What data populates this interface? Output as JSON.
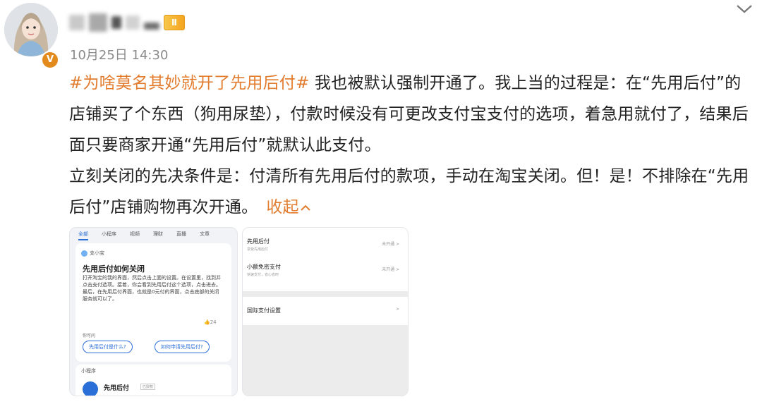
{
  "user": {
    "name_hidden": "",
    "level_badge": "Ⅱ",
    "verified_badge": "V"
  },
  "post": {
    "timestamp": "10月25日 14:30",
    "hashtag": "#为啥莫名其妙就开了先用后付#",
    "paragraph1": " 我也被默认强制开通了。我上当的过程是：在“先用后付”的店铺买了个东西（狗用尿垫），付款时候没有可更改支付宝支付的选项，着急用就付了，结果后面只要商家开通“先用后付”就默认此支付。",
    "paragraph2": "立刻关闭的先决条件是：付清所有先用后付的款项，手动在淘宝关闭。但！是！不排除在“先用后付”店铺购物再次开通。",
    "collapse_label": "收起"
  },
  "thumb1": {
    "tabs": [
      "全部",
      "小程序",
      "视频",
      "理财",
      "直播",
      "文章"
    ],
    "assistant": "支小宝",
    "title": "先用后付如何关闭",
    "body": "打开淘宝的我的界面，然后点击上面的设置。在设置里，找到并点击支付选项。接着，你会看到先用后付这个选项，点击进去。最后，在先用后付界面，也就是0元付的界面，点击底部的关闭服务就可以了。",
    "like_count": "24",
    "related_label": "你可问",
    "pill1": "先用后付是什么?",
    "pill2": "如何申请先用后付?",
    "mini_label": "小程序",
    "mini_title": "先用后付",
    "mini_badge": "已授权"
  },
  "thumb2": {
    "rows": [
      {
        "title": "先用后付",
        "sub": "享受先用后付",
        "value": "未开通 >"
      },
      {
        "title": "小额免密支付",
        "sub": "快速支付，省心省时",
        "value": "未开通 >"
      }
    ],
    "intl": "国际支付设置",
    "intl_arrow": ">"
  }
}
